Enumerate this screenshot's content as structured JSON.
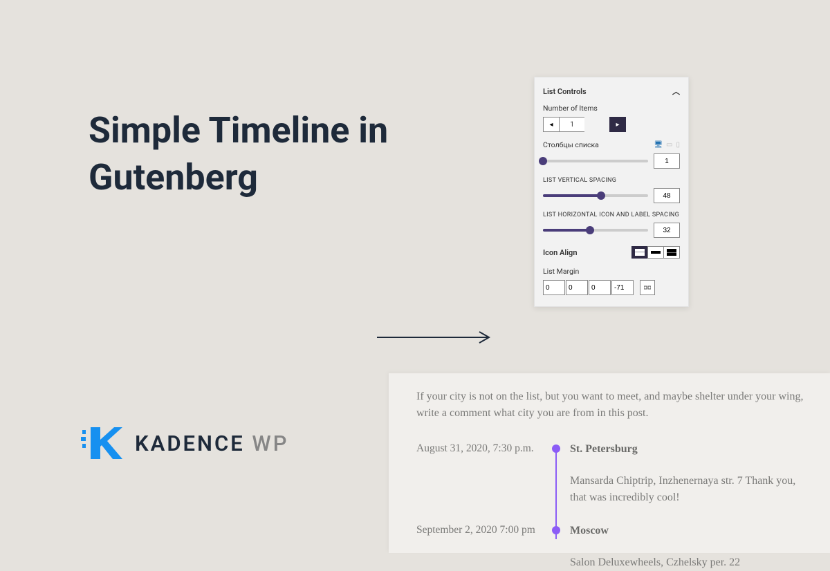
{
  "title": "Simple Timeline in Gutenberg",
  "brand": {
    "name": "KADENCE",
    "suffix": "WP"
  },
  "colors": {
    "accent": "#8b5cf6",
    "dark": "#4a3d7a",
    "bg": "#e5e2dd"
  },
  "panel": {
    "title": "List Controls",
    "number_of_items": {
      "label": "Number of Items",
      "value": "1"
    },
    "columns": {
      "label": "Столбцы списка",
      "value": "1",
      "percent": 0
    },
    "vertical_spacing": {
      "label": "LIST VERTICAL SPACING",
      "value": "48",
      "percent": 55
    },
    "horizontal_spacing": {
      "label": "LIST HORIZONTAL ICON AND LABEL SPACING",
      "value": "32",
      "percent": 45
    },
    "icon_align": {
      "label": "Icon Align"
    },
    "list_margin": {
      "label": "List Margin",
      "top": "0",
      "right": "0",
      "bottom": "0",
      "left": "-71"
    }
  },
  "preview": {
    "intro": "If your city is not on the list, but you want to meet, and maybe shelter under your wing, write a comment what city you are from in this post.",
    "items": [
      {
        "date": "August 31, 2020, 7:30 p.m.",
        "city": "St. Petersburg",
        "desc": "Mansarda Chiptrip, Inzhenernaya str. 7 Thank you, that was incredibly cool!"
      },
      {
        "date": "September 2, 2020 7:00 pm",
        "city": "Moscow",
        "desc": "Salon Deluxewheels, Czhelsky per. 22"
      }
    ]
  }
}
